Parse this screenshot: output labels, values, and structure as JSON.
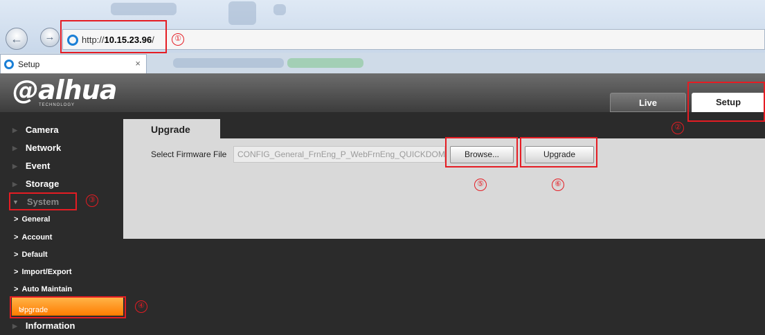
{
  "browser": {
    "url_prefix": "http://",
    "url_host": "10.15.23.96",
    "url_suffix": "/",
    "tab_title": "Setup",
    "tab_close": "×",
    "back_icon": "back-arrow-icon",
    "forward_icon": "forward-arrow-icon"
  },
  "header": {
    "logo_text": "alhua",
    "logo_sub": "TECHNOLOGY",
    "tabs": [
      {
        "label": "Live",
        "active": false
      },
      {
        "label": "Setup",
        "active": true
      }
    ]
  },
  "sidebar": {
    "items": [
      {
        "label": "Camera"
      },
      {
        "label": "Network"
      },
      {
        "label": "Event"
      },
      {
        "label": "Storage"
      },
      {
        "label": "System",
        "expanded": true
      },
      {
        "label": "Information"
      }
    ],
    "system_sub": [
      {
        "label": "General"
      },
      {
        "label": "Account"
      },
      {
        "label": "Default"
      },
      {
        "label": "Import/Export"
      },
      {
        "label": "Auto Maintain"
      },
      {
        "label": "Upgrade",
        "active": true
      }
    ]
  },
  "content": {
    "tab_title": "Upgrade",
    "field_label": "Select Firmware File",
    "file_value": "CONFIG_General_FrnEng_P_WebFrnEng_QUICKDOME",
    "browse_label": "Browse...",
    "upgrade_label": "Upgrade"
  },
  "annotations": [
    "①",
    "②",
    "③",
    "④",
    "⑤",
    "⑥"
  ],
  "colors": {
    "callout": "#e51c23",
    "active_menu": "#ff8c1a",
    "panel_bg": "#d9d9d9",
    "page_bg": "#2b2b2b"
  }
}
